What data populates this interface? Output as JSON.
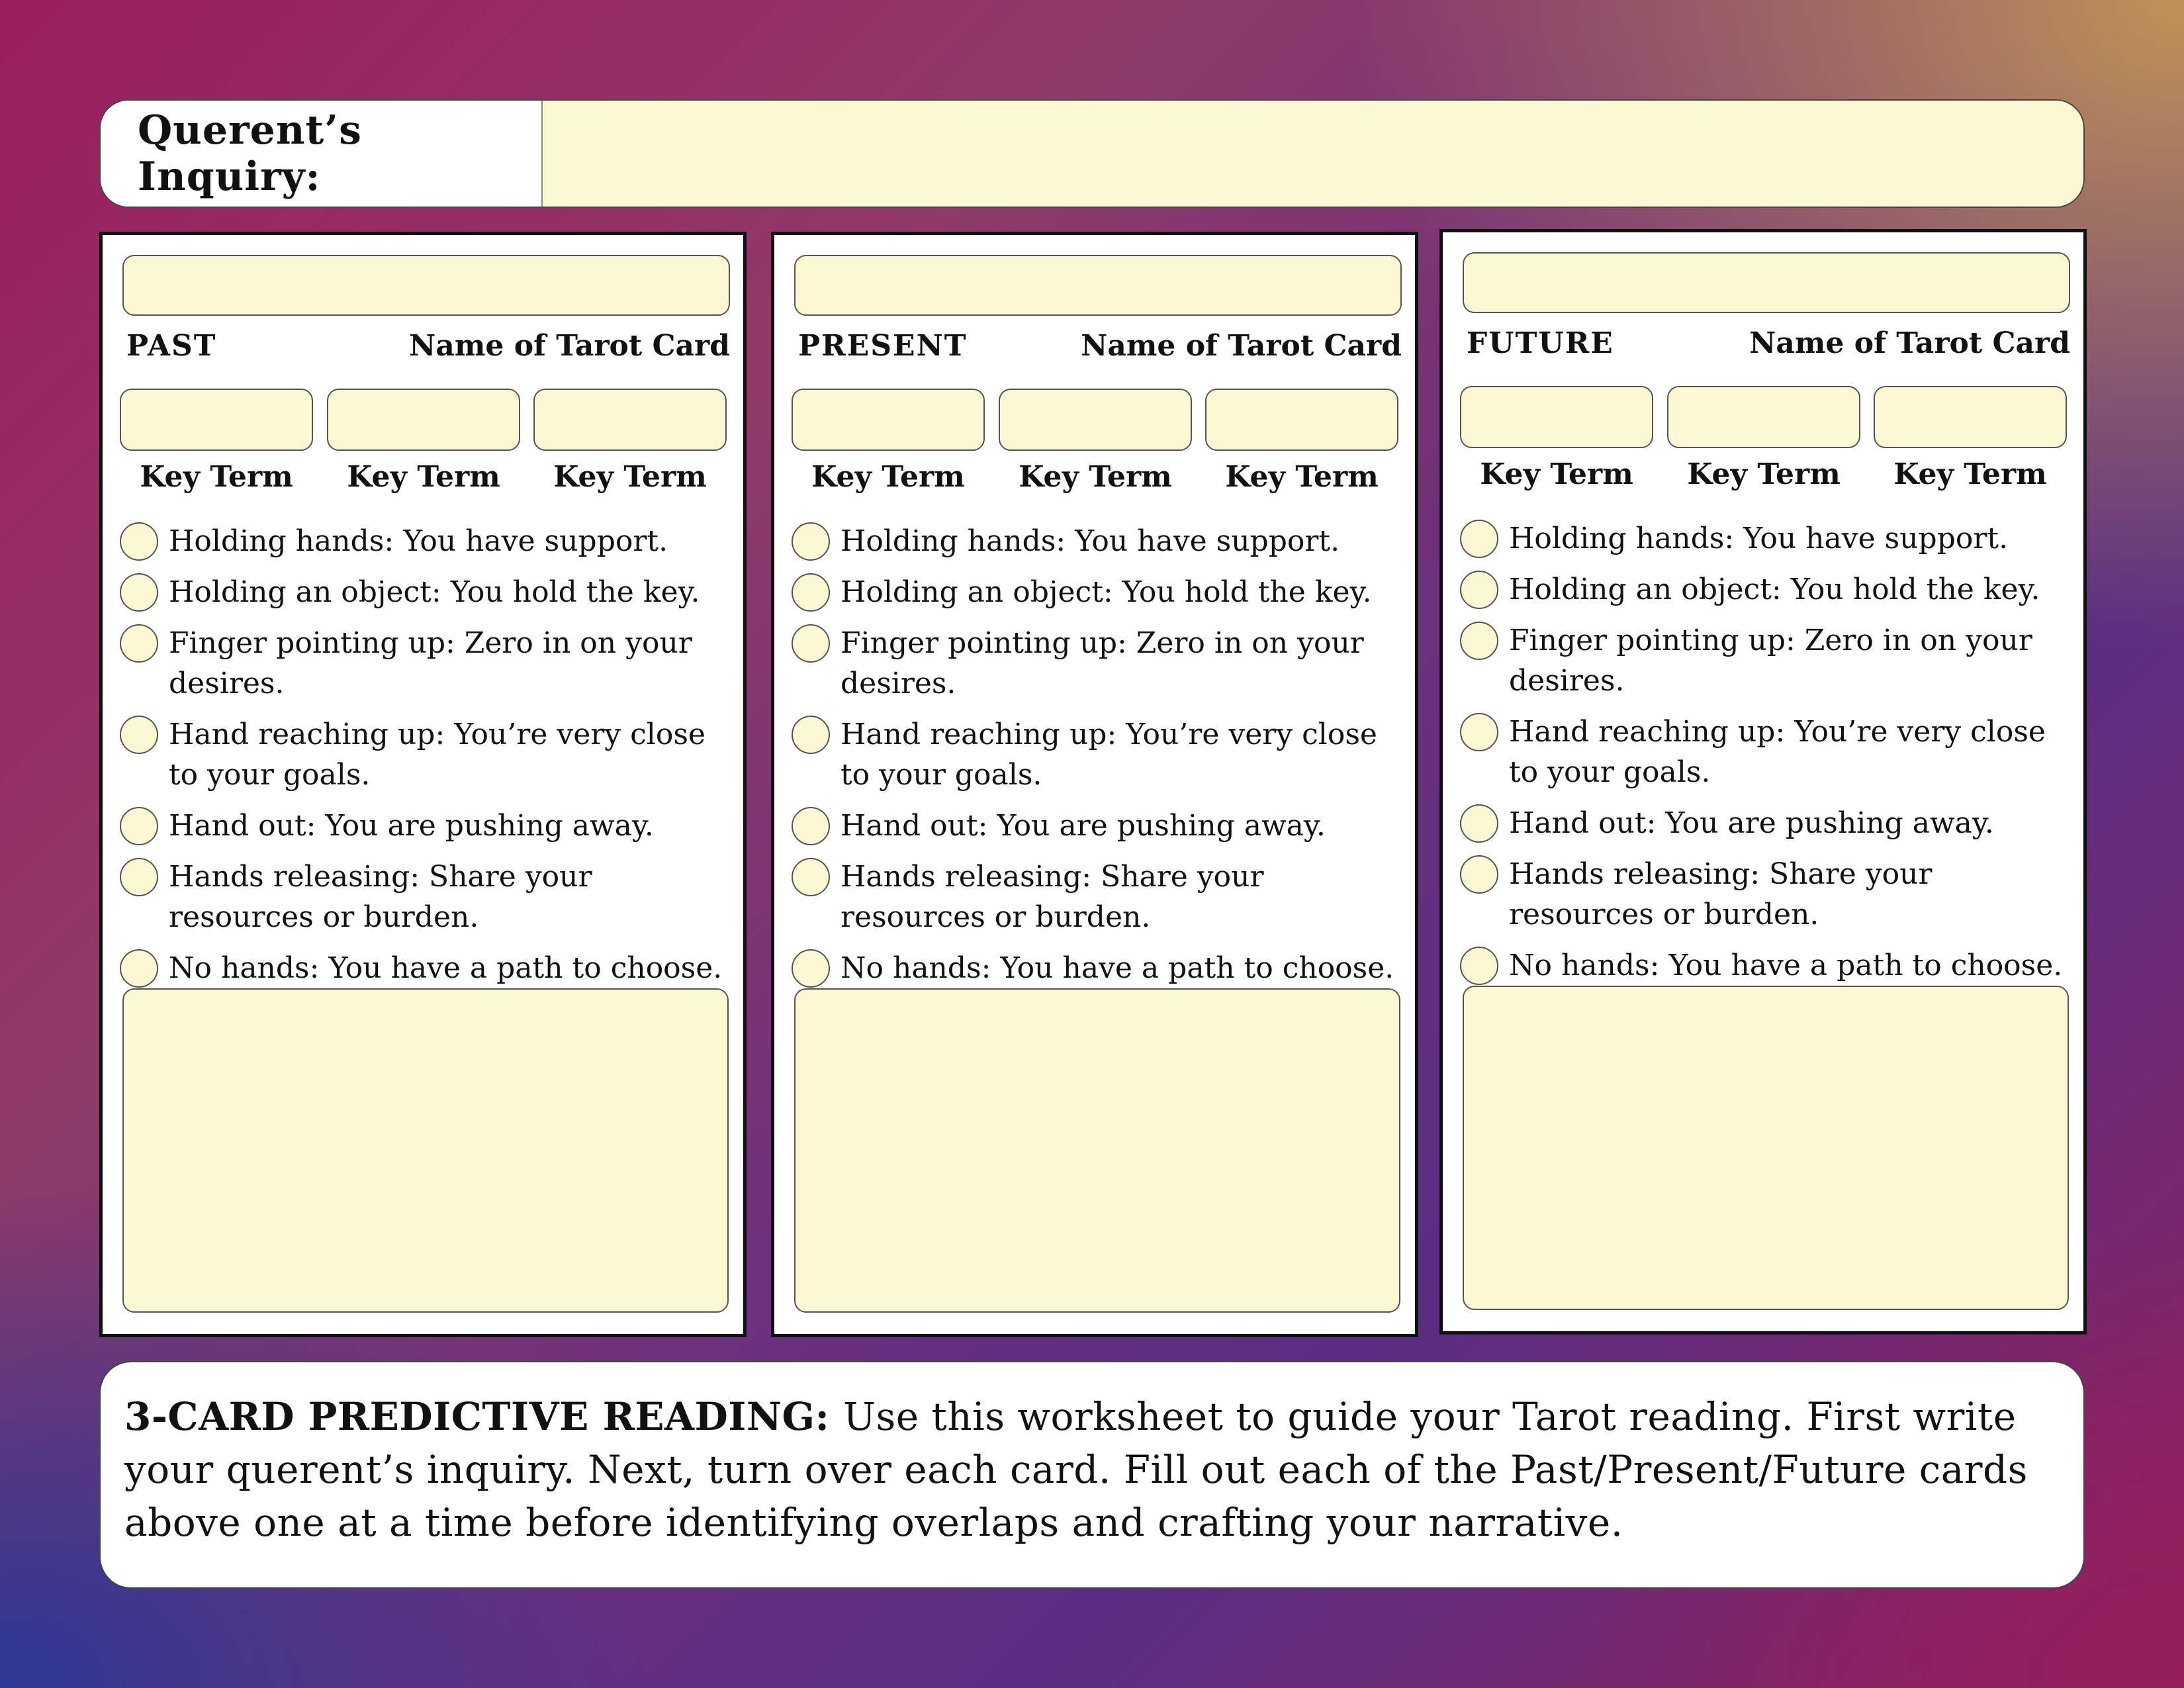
{
  "inquiry": {
    "label": "Querent’s Inquiry:"
  },
  "cards": [
    {
      "position": "PAST",
      "name_label": "Name of Tarot Card"
    },
    {
      "position": "PRESENT",
      "name_label": "Name of Tarot Card"
    },
    {
      "position": "FUTURE",
      "name_label": "Name of Tarot Card"
    }
  ],
  "key_term_label": "Key Term",
  "options": [
    "Holding hands: You have support.",
    "Holding an object: You hold the key.",
    "Finger pointing up: Zero in on your desires.",
    "Hand reaching up: You’re very close to your goals.",
    "Hand out: You are pushing away.",
    "Hands releasing: Share your resources or burden.",
    "No hands: You have a path to choose."
  ],
  "instructions": {
    "heading": "3-CARD PREDICTIVE READING:",
    "body": "Use this worksheet to guide your Tarot reading. First write your querent’s inquiry. Next, turn over each card. Fill out each of the Past/Present/Future cards above one at a time before identifying overlaps and crafting your narrative."
  },
  "colors": {
    "field_fill": "#fdf8d4",
    "bg_top_left": "#9b1d5c",
    "bg_top_right": "#c49854",
    "bg_bottom_left": "#283896",
    "bg_bottom_right": "#961c5a"
  }
}
